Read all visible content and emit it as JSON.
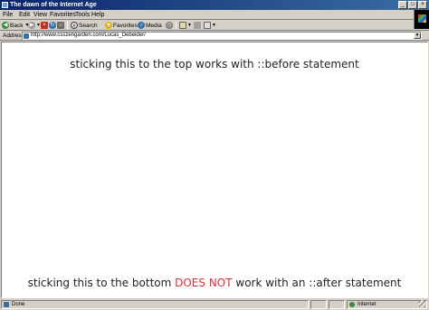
{
  "window": {
    "title": "The dawn of the Internet Age"
  },
  "menu": {
    "items": [
      "File",
      "Edit",
      "View",
      "Favorites",
      "Tools",
      "Help"
    ]
  },
  "toolbar": {
    "back_label": "Back",
    "search_label": "Search",
    "favorites_label": "Favorites",
    "media_label": "Media"
  },
  "address": {
    "label": "Address",
    "url": "http://www.csszengarden.com/Lucas_Debeider/"
  },
  "content": {
    "top_text": "sticking this to the top works with ::before statement",
    "bottom_before": "sticking this to the bottom ",
    "bottom_highlight": "DOES NOT",
    "bottom_after": " work with an ::after statement",
    "highlight_color": "#d8303a"
  },
  "status": {
    "text": "Done",
    "zone": "Internet"
  }
}
